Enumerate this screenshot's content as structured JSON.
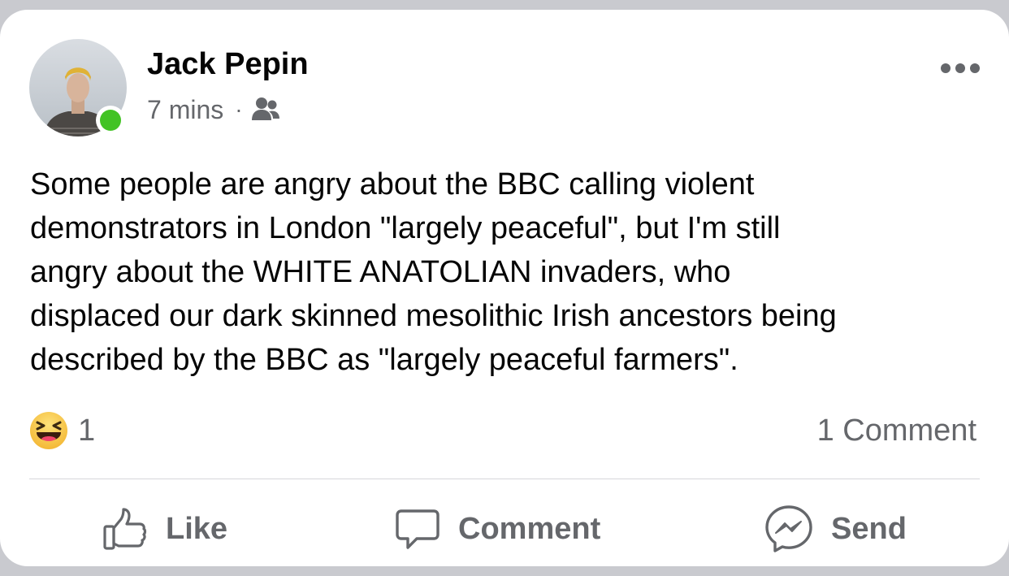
{
  "post": {
    "author": "Jack Pepin",
    "timestamp": "7 mins",
    "separator": "·",
    "audience_icon": "friends-icon",
    "online_status": "online",
    "online_color": "#42c324",
    "text_lines": [
      "Some people are angry about the BBC calling violent",
      "demonstrators in London \"largely peaceful\", but I'm still",
      "angry about the WHITE ANATOLIAN invaders, who",
      "displaced our dark skinned mesolithic Irish ancestors being",
      "described by the BBC as \"largely peaceful farmers\"."
    ]
  },
  "reactions": {
    "icon": "haha-icon",
    "count": "1",
    "comments_label": "1 Comment"
  },
  "actions": {
    "like_label": "Like",
    "like_icon": "thumbs-up-icon",
    "comment_label": "Comment",
    "comment_icon": "speech-bubble-icon",
    "send_label": "Send",
    "send_icon": "messenger-icon"
  },
  "colors": {
    "primary_text": "#050505",
    "secondary_text": "#65676b",
    "haha_yellow": "#f7c53e",
    "background": "#c9cacf"
  }
}
